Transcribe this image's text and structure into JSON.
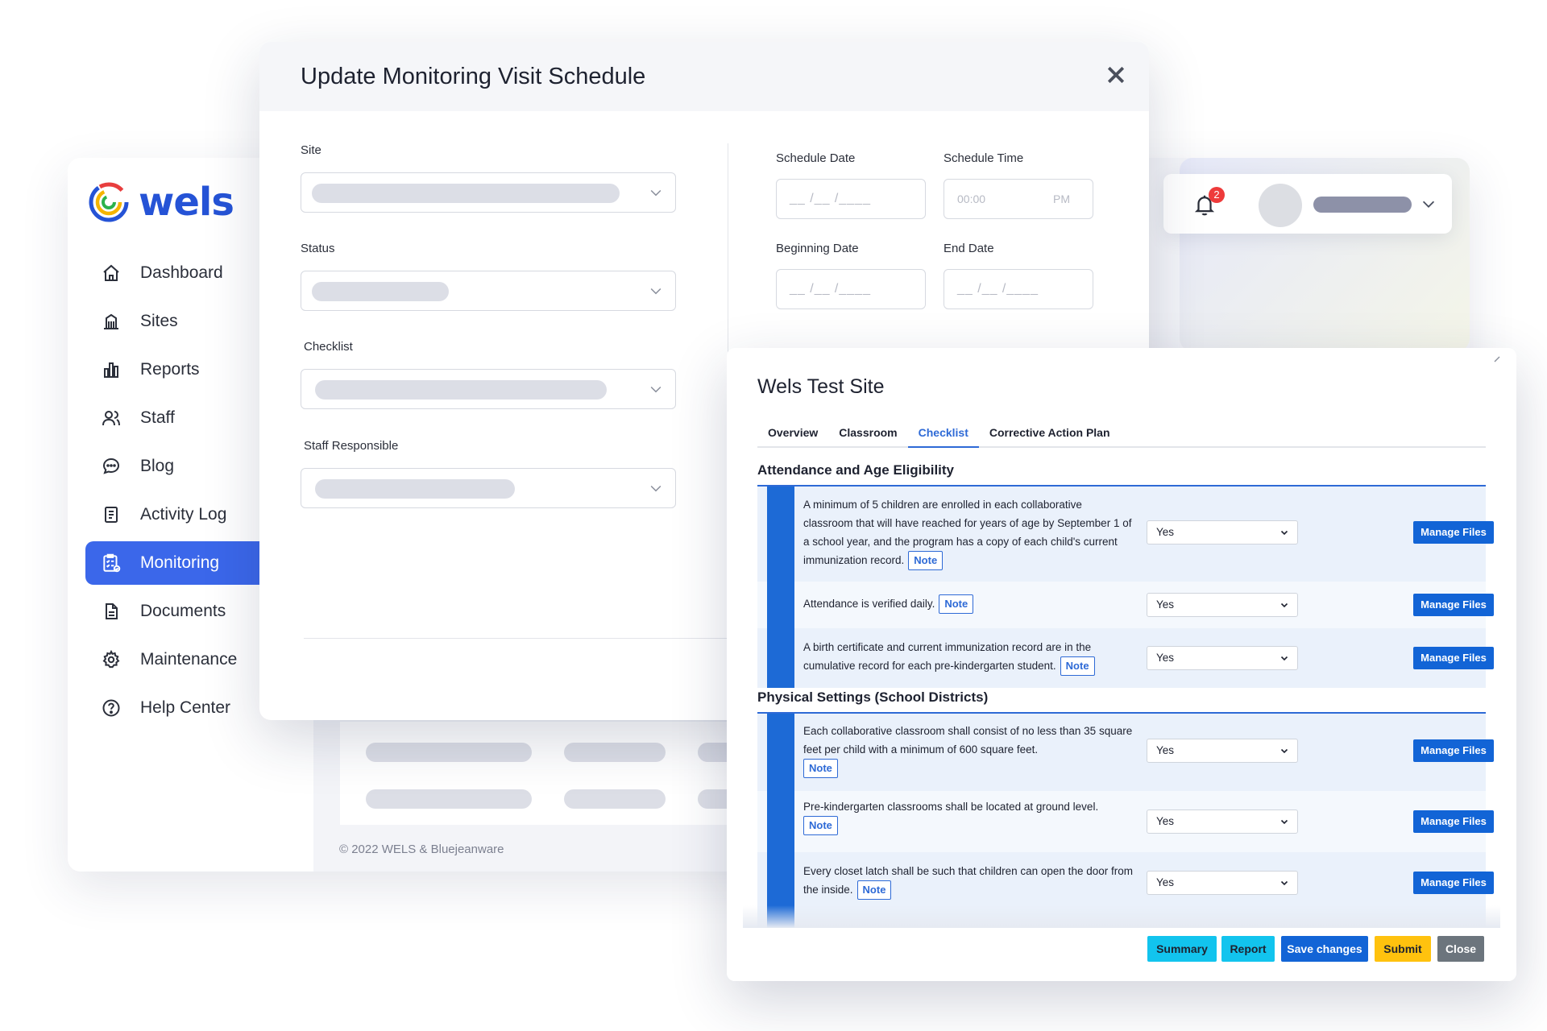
{
  "brand": {
    "name": "wels"
  },
  "sidebar": {
    "items": [
      {
        "label": "Dashboard",
        "icon": "home-icon"
      },
      {
        "label": "Sites",
        "icon": "building-icon"
      },
      {
        "label": "Reports",
        "icon": "bar-chart-icon"
      },
      {
        "label": "Staff",
        "icon": "users-icon"
      },
      {
        "label": "Blog",
        "icon": "chat-bubble-icon"
      },
      {
        "label": "Activity Log",
        "icon": "clipboard-list-icon"
      },
      {
        "label": "Monitoring",
        "icon": "checklist-icon",
        "active": true
      },
      {
        "label": "Documents",
        "icon": "document-icon"
      },
      {
        "label": "Maintenance",
        "icon": "gear-icon"
      },
      {
        "label": "Help Center",
        "icon": "help-circle-icon"
      }
    ]
  },
  "footer": {
    "copyright": "© 2022 WELS & Bluejeanware"
  },
  "header": {
    "notification_count": "2"
  },
  "schedule_modal": {
    "title": "Update Monitoring Visit Schedule",
    "site_label": "Site",
    "status_label": "Status",
    "checklist_label": "Checklist",
    "staff_label": "Staff Responsible",
    "schedule_date_label": "Schedule Date",
    "schedule_time_label": "Schedule Time",
    "beginning_date_label": "Beginning Date",
    "end_date_label": "End Date",
    "date_placeholder": "__ /__ /____",
    "time_placeholder": "00:00",
    "time_period": "PM"
  },
  "checklist_modal": {
    "title": "Wels Test Site",
    "tabs": [
      "Overview",
      "Classroom",
      "Checklist",
      "Corrective Action Plan"
    ],
    "active_tab": "Checklist",
    "note_label": "Note",
    "manage_files_label": "Manage Files",
    "sections": [
      {
        "title": "Attendance and Age Eligibility",
        "items": [
          {
            "text": "A minimum of 5 children are enrolled in each collaborative classroom that will have reached for years of age by September 1 of a school year, and the program has a copy of each child's current immunization record.",
            "value": "Yes"
          },
          {
            "text": "Attendance is verified daily.",
            "value": "Yes"
          },
          {
            "text": "A birth certificate and current immunization record are in the cumulative record for each pre-kindergarten student.",
            "value": "Yes"
          }
        ]
      },
      {
        "title": "Physical Settings (School Districts)",
        "items": [
          {
            "text": "Each collaborative classroom shall consist of no less than 35 square feet per child with a minimum of 600 square feet.",
            "value": "Yes"
          },
          {
            "text": "Pre-kindergarten classrooms shall be located at ground level.",
            "value": "Yes"
          },
          {
            "text": "Every closet latch shall be such that children can open the door from the inside.",
            "value": "Yes"
          }
        ]
      }
    ],
    "footer_buttons": {
      "summary": "Summary",
      "report": "Report",
      "save": "Save changes",
      "submit": "Submit",
      "close": "Close"
    }
  },
  "colors": {
    "brand_blue": "#2553d6",
    "active_nav": "#3b67ea",
    "primary_button": "#1264d6",
    "cyan_button": "#12c4ee",
    "submit_button": "#ffc20e",
    "close_button": "#6c757d",
    "badge_red": "#ee3b3b"
  }
}
